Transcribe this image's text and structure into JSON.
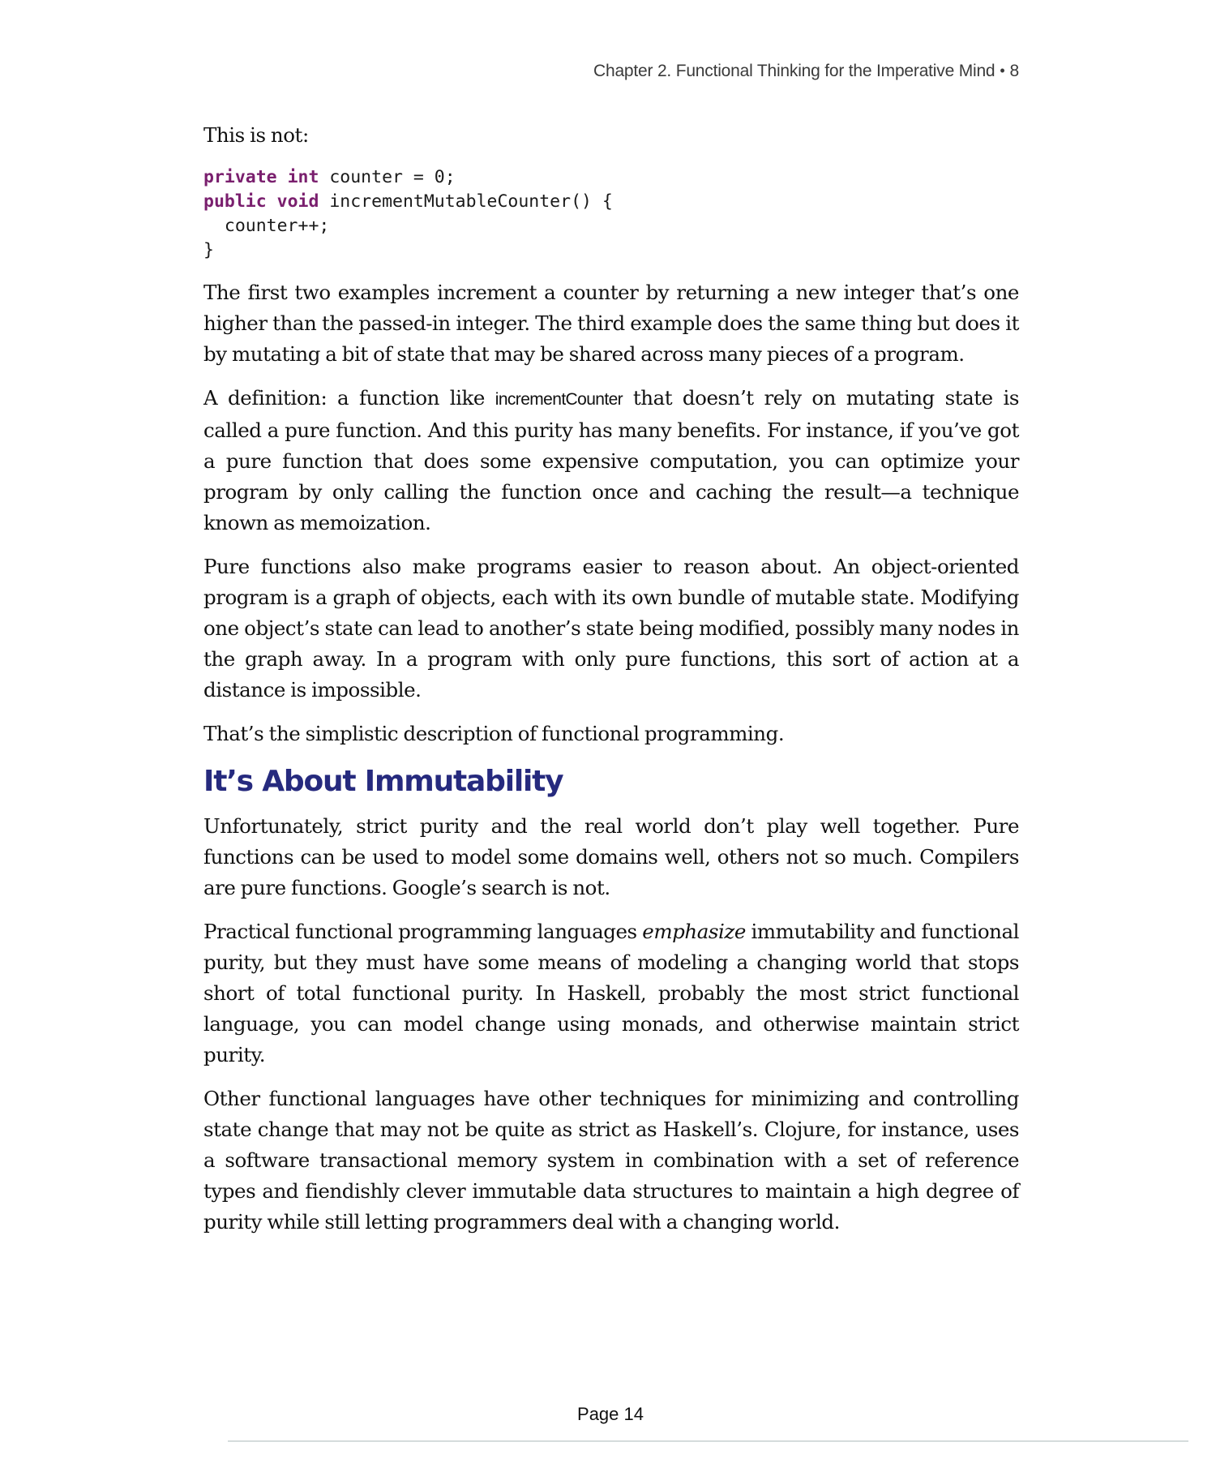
{
  "header": {
    "chapter_title": "Chapter 2. Functional Thinking for the Imperative Mind",
    "separator": "•",
    "book_page": "8"
  },
  "intro": "This is not:",
  "code_block": {
    "lines": [
      {
        "kw1": "private",
        "kw2": "int",
        "rest": " counter = 0;"
      },
      {
        "kw1": "public",
        "kw2": "void",
        "rest": " incrementMutableCounter() {"
      },
      {
        "kw1": "",
        "kw2": "",
        "rest": "  counter++;"
      },
      {
        "kw1": "",
        "kw2": "",
        "rest": "}"
      }
    ]
  },
  "paragraphs": {
    "p1": "The first two examples increment a counter by returning a new integer that’s one higher than the passed-in integer. The third example does the same thing but does it by mutating a bit of state that may be shared across many pieces of a program.",
    "p2_before": "A definition: a function like ",
    "p2_code": "incrementCounter",
    "p2_after": " that doesn’t rely on mutating state is called a pure function. And this purity has many benefits. For instance, if you’ve got a pure function that does some expensive computation, you can optimize your program by only calling the function once and caching the result—a technique known as memoization.",
    "p3": "Pure functions also make programs easier to reason about. An object-oriented program is a graph of objects, each with its own bundle of mutable state. Modifying one object’s state can lead to another’s state being modified, possibly many nodes in the graph away. In a program with only pure functions, this sort of action at a distance is impossible.",
    "p4": "That’s the simplistic description of functional programming."
  },
  "section": {
    "heading": "It’s About Immutability",
    "p1": "Unfortunately, strict purity and the real world don’t play well together. Pure functions can be used to model some domains well, others not so much. Compilers are pure functions. Google’s search is not.",
    "p2_before": "Practical functional programming languages ",
    "p2_em": "emphasize",
    "p2_after": " immutability and functional purity, but they must have some means of modeling a changing world that stops short of total functional purity. In Haskell, probably the most strict functional language, you can model change using monads, and otherwise maintain strict purity.",
    "p3": "Other functional languages have other techniques for minimizing and controlling state change that may not be quite as strict as Haskell’s. Clojure, for instance, uses a software transactional memory system in combination with a set of reference types and fiendishly clever immutable data structures to maintain a high degree of purity while still letting programmers deal with a changing world."
  },
  "footer": {
    "page_label": "Page 14"
  },
  "colors": {
    "heading": "#262a7e",
    "keyword": "#7a1f6e",
    "body_text": "#111111",
    "running_head": "#3a3a3a",
    "footer_rule": "#d5dcdc"
  }
}
